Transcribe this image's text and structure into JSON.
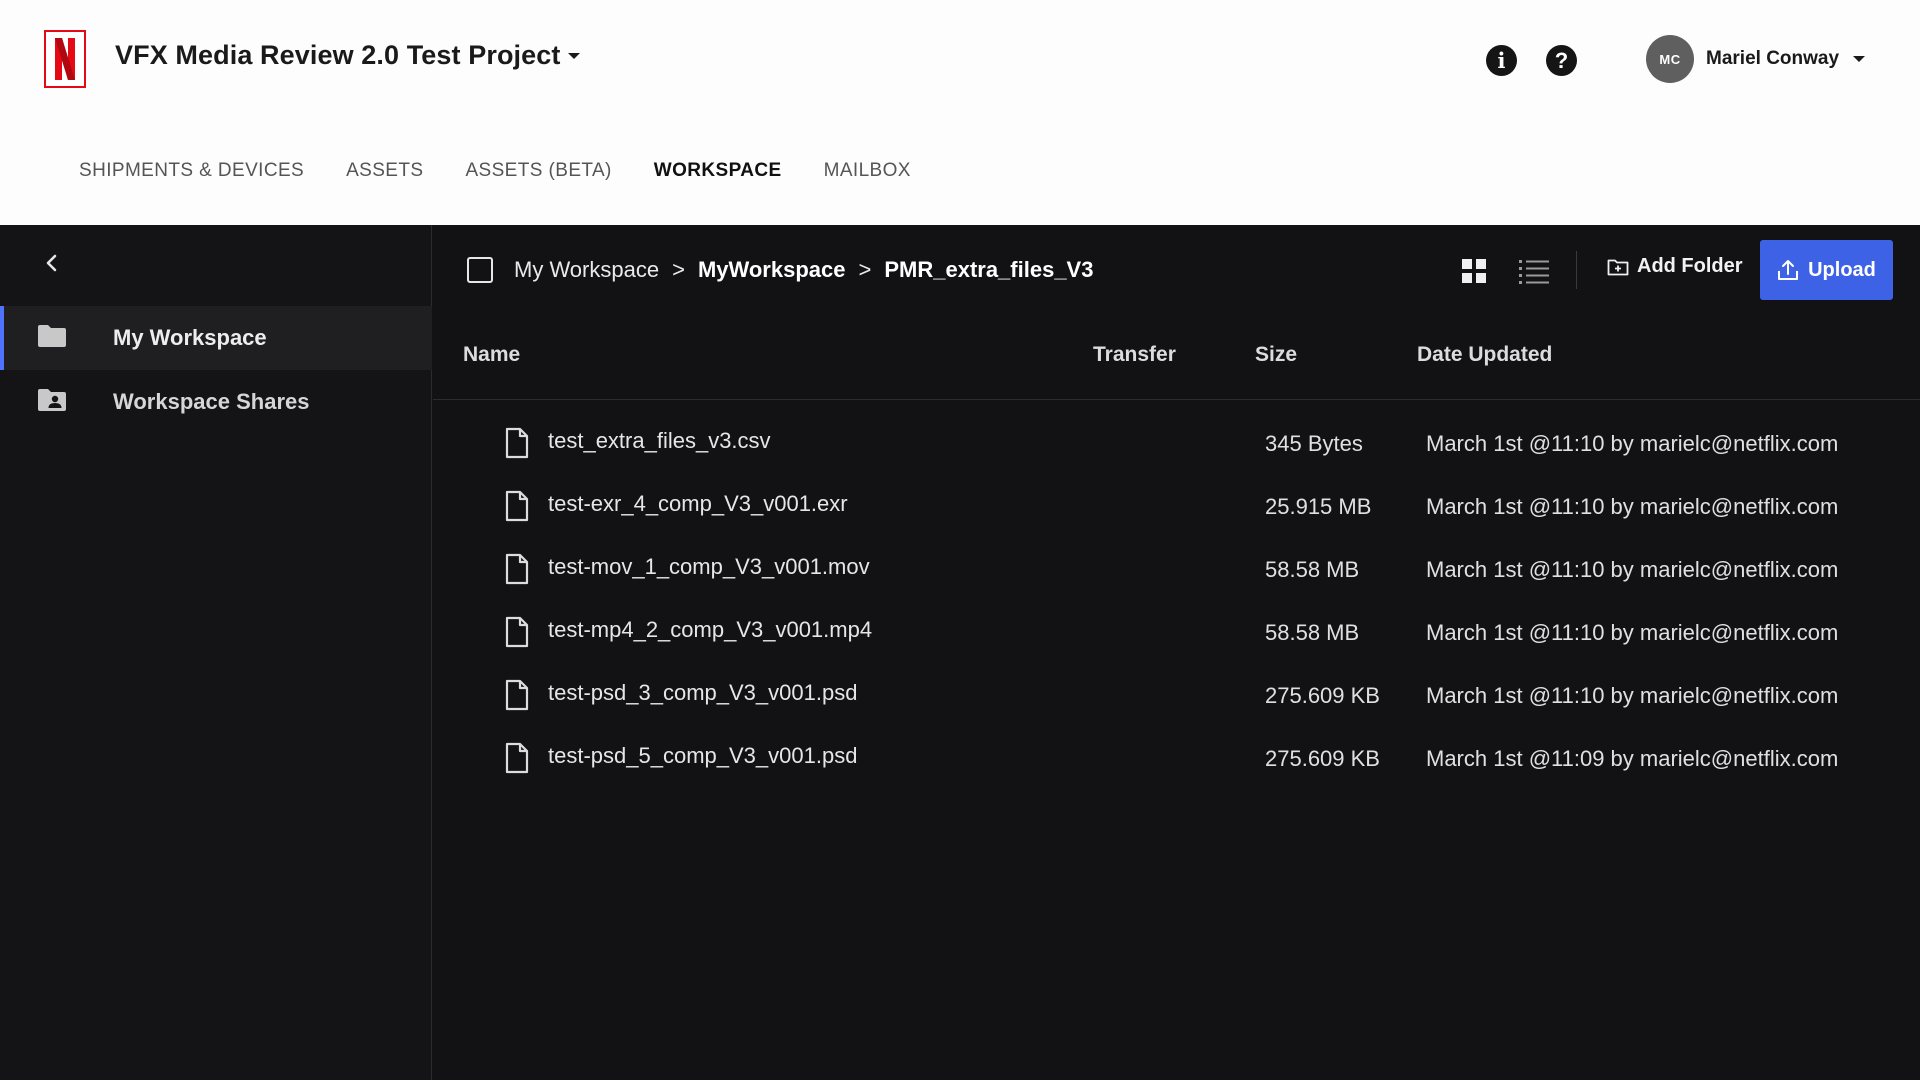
{
  "header": {
    "project_title": "VFX Media Review 2.0 Test Project",
    "info_glyph": "i",
    "help_glyph": "?",
    "user_initials": "MC",
    "user_name": "Mariel Conway"
  },
  "nav": {
    "items": [
      {
        "label": "SHIPMENTS & DEVICES"
      },
      {
        "label": "ASSETS"
      },
      {
        "label": "ASSETS (BETA)"
      },
      {
        "label": "WORKSPACE"
      },
      {
        "label": "MAILBOX"
      }
    ],
    "active": "WORKSPACE"
  },
  "sidebar": {
    "items": [
      {
        "label": "My Workspace",
        "icon": "folder-icon"
      },
      {
        "label": "Workspace Shares",
        "icon": "shared-folder-icon"
      }
    ]
  },
  "breadcrumb": {
    "items": [
      "My Workspace",
      "MyWorkspace",
      "PMR_extra_files_V3"
    ],
    "separator": ">"
  },
  "toolbar": {
    "add_folder_label": "Add Folder",
    "upload_label": "Upload"
  },
  "table": {
    "headers": {
      "name": "Name",
      "transfer": "Transfer",
      "size": "Size",
      "date": "Date Updated"
    },
    "rows": [
      {
        "name": "test_extra_files_v3.csv",
        "size": "345 Bytes",
        "date": "March 1st @11:10 by marielc@netflix.com"
      },
      {
        "name": "test-exr_4_comp_V3_v001.exr",
        "size": "25.915 MB",
        "date": "March 1st @11:10 by marielc@netflix.com"
      },
      {
        "name": "test-mov_1_comp_V3_v001.mov",
        "size": "58.58 MB",
        "date": "March 1st @11:10 by marielc@netflix.com"
      },
      {
        "name": "test-mp4_2_comp_V3_v001.mp4",
        "size": "58.58 MB",
        "date": "March 1st @11:10 by marielc@netflix.com"
      },
      {
        "name": "test-psd_3_comp_V3_v001.psd",
        "size": "275.609 KB",
        "date": "March 1st @11:10 by marielc@netflix.com"
      },
      {
        "name": "test-psd_5_comp_V3_v001.psd",
        "size": "275.609 KB",
        "date": "March 1st @11:09 by marielc@netflix.com"
      }
    ]
  },
  "colors": {
    "accent": "#3d62e6",
    "brand_red": "#e50914",
    "sidebar_active_bar": "#4f72ff",
    "background_dark": "#121214",
    "header_bg": "#fdfdfd"
  }
}
